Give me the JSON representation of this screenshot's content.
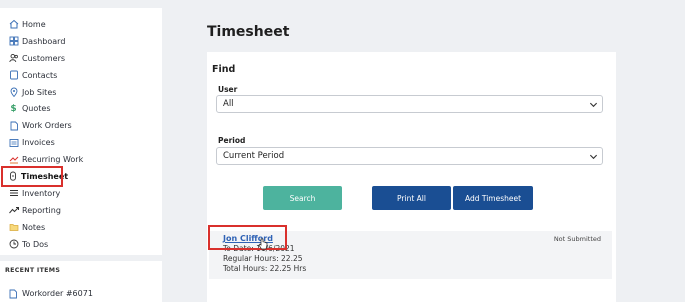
{
  "sidebar": {
    "items": [
      {
        "label": "Home",
        "icon": "home-icon"
      },
      {
        "label": "Dashboard",
        "icon": "dashboard-icon"
      },
      {
        "label": "Customers",
        "icon": "users-icon"
      },
      {
        "label": "Contacts",
        "icon": "contacts-icon"
      },
      {
        "label": "Job Sites",
        "icon": "location-pin-icon"
      },
      {
        "label": "Quotes",
        "icon": "dollar-icon"
      },
      {
        "label": "Work Orders",
        "icon": "document-icon"
      },
      {
        "label": "Invoices",
        "icon": "invoice-icon"
      },
      {
        "label": "Recurring Work",
        "icon": "recurring-icon"
      },
      {
        "label": "Timesheet",
        "icon": "stopwatch-icon"
      },
      {
        "label": "Inventory",
        "icon": "list-icon"
      },
      {
        "label": "Reporting",
        "icon": "trend-icon"
      },
      {
        "label": "Notes",
        "icon": "folder-icon"
      },
      {
        "label": "To Dos",
        "icon": "clock-icon"
      }
    ],
    "highlighted": "Timesheet"
  },
  "recent": {
    "title": "RECENT ITEMS",
    "items": [
      {
        "label": "Workorder #6071",
        "icon": "document-icon"
      }
    ]
  },
  "page": {
    "title": "Timesheet"
  },
  "find": {
    "title": "Find",
    "user_label": "User",
    "user_value": "All",
    "period_label": "Period",
    "period_value": "Current Period"
  },
  "buttons": {
    "search": "Search",
    "print_all": "Print All",
    "add_timesheet": "Add Timesheet"
  },
  "entry": {
    "name": "Jon Clifford",
    "date_line": "To Date: 11/6/2021",
    "regular_hours": "Regular Hours: 22.25",
    "total_hours": "Total Hours: 22.25 Hrs",
    "status": "Not Submitted"
  },
  "colors": {
    "accent_teal": "#4db39e",
    "primary_blue": "#1a4e93",
    "highlight_red": "#d9302c",
    "link_blue": "#2f62b5"
  }
}
